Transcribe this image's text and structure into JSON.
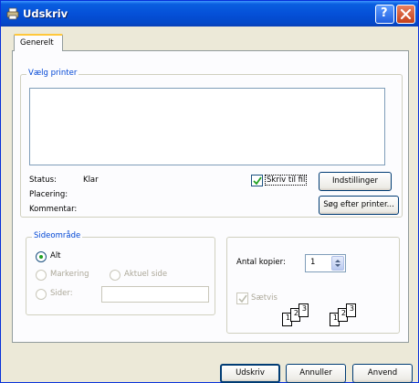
{
  "window": {
    "title": "Udskriv",
    "help_glyph": "?",
    "close_glyph": "×"
  },
  "tabs": [
    {
      "label": "Generelt"
    }
  ],
  "printer_group": {
    "label": "Vælg printer",
    "status_label": "Status:",
    "status_value": "Klar",
    "location_label": "Placering:",
    "comment_label": "Kommentar:",
    "print_to_file_label": "Skriv til fil",
    "print_to_file_checked": true,
    "settings_button": "Indstillinger",
    "find_printer_button": "Søg efter printer..."
  },
  "range_group": {
    "label": "Sideområde",
    "all_label": "Alt",
    "selection_label": "Markering",
    "current_page_label": "Aktuel side",
    "pages_label": "Sider:",
    "pages_value": "",
    "selected": "all"
  },
  "copies_group": {
    "copies_label": "Antal kopier:",
    "copies_value": "1",
    "collate_label": "Sætvis",
    "collate_checked": true,
    "collate_pages": [
      "1",
      "2",
      "3",
      "1",
      "2",
      "3"
    ]
  },
  "footer": {
    "print_button": "Udskriv",
    "cancel_button": "Annuller",
    "apply_button": "Anvend"
  },
  "colors": {
    "title_blue": "#0550d8",
    "group_label_blue": "#0046d5",
    "dialog_bg": "#ece9d8",
    "panel_bg": "#fcfcfe"
  }
}
